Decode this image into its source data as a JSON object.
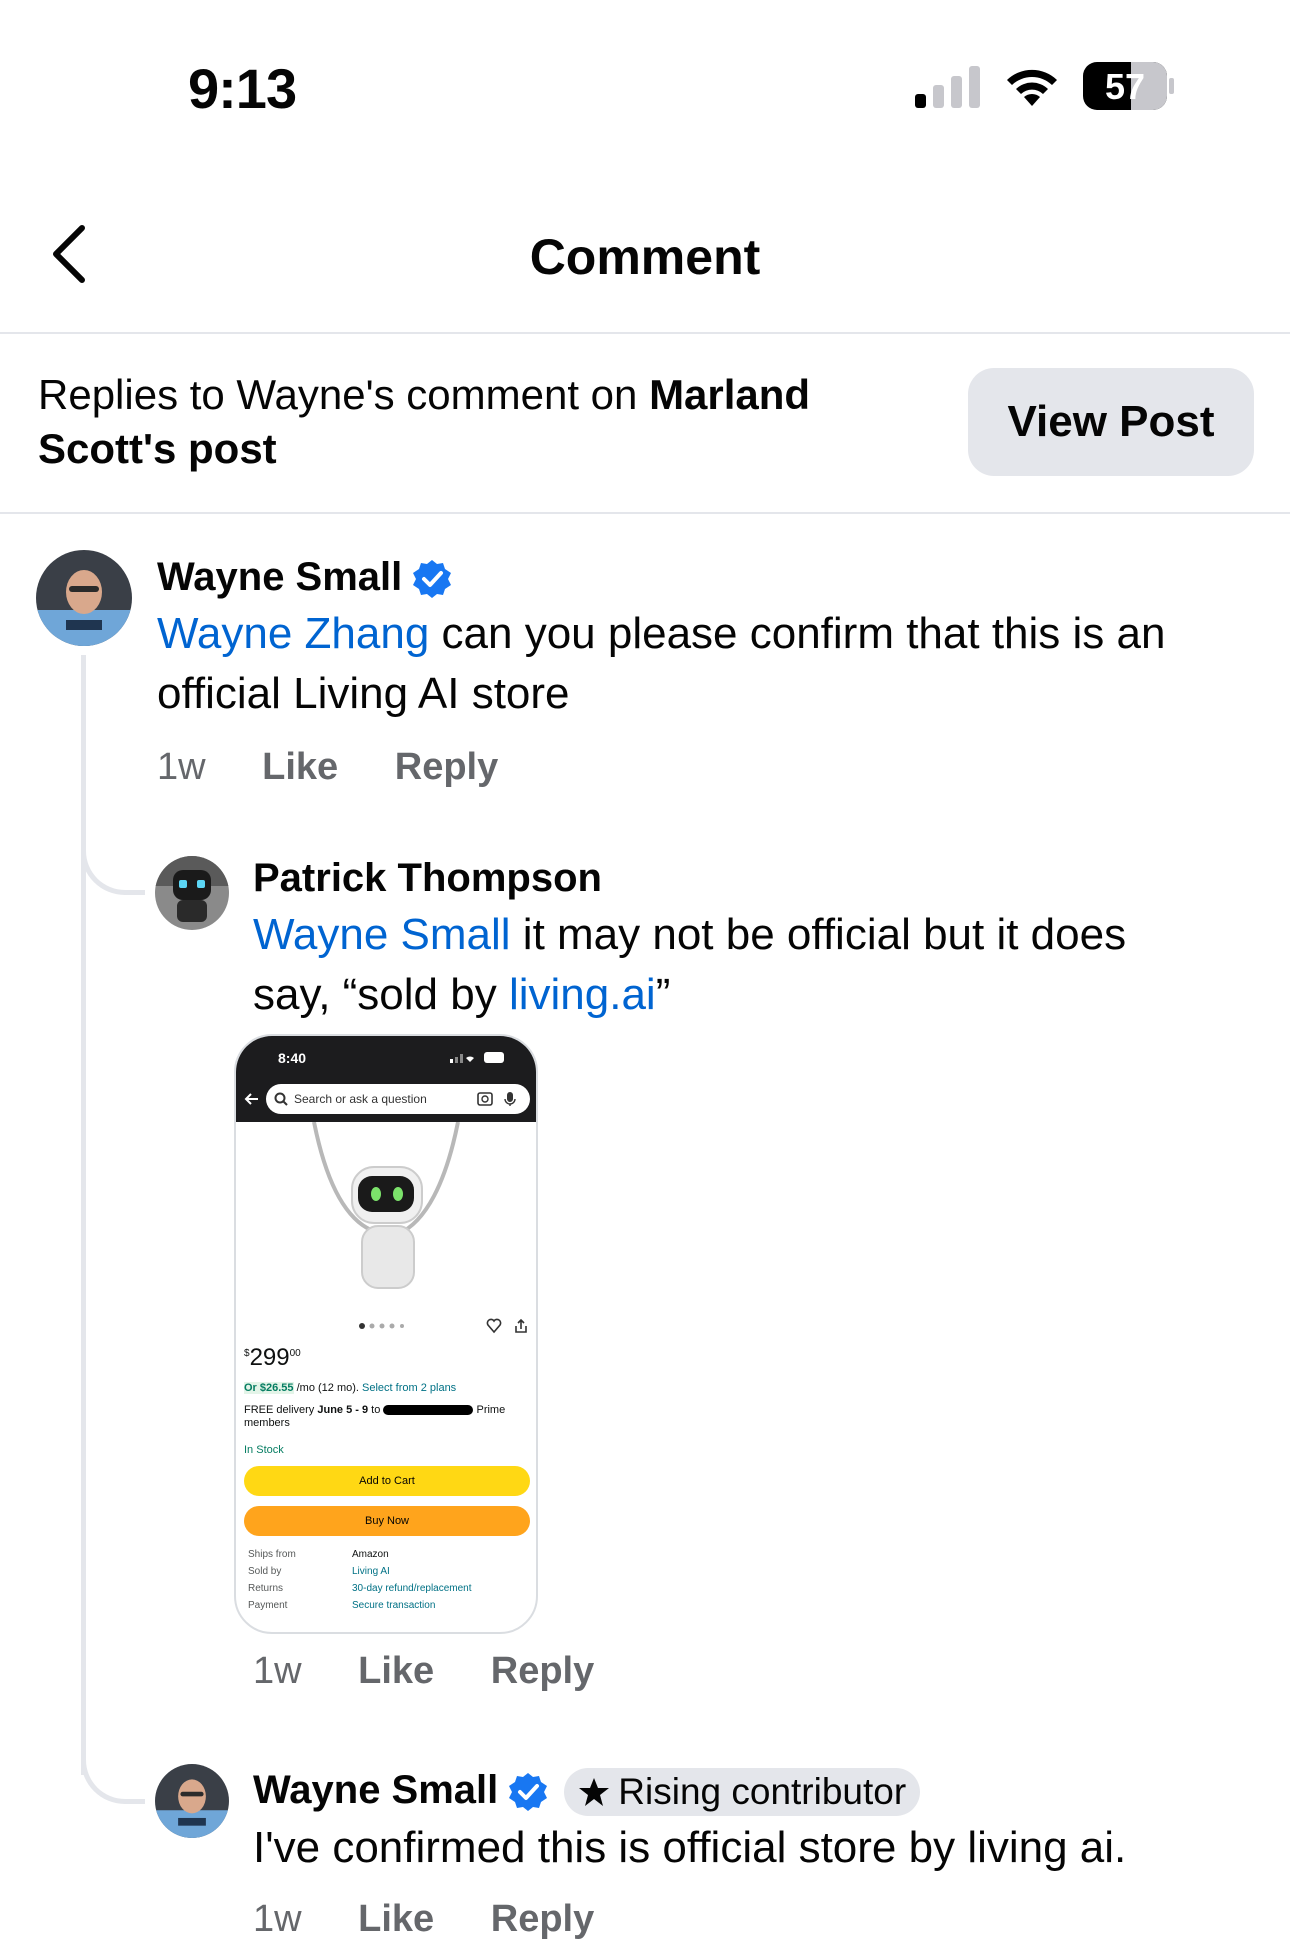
{
  "status_bar": {
    "time": "9:13",
    "battery": "57"
  },
  "header": {
    "title": "Comment"
  },
  "context": {
    "prefix": "Replies to Wayne's comment on ",
    "author": "Marland Scott",
    "suffix": "'s post",
    "view_post_label": "View Post"
  },
  "comments": [
    {
      "name": "Wayne Small",
      "mention": "Wayne Zhang",
      "text": " can you please confirm that this is an official Living AI store",
      "time": "1w",
      "like": "Like",
      "reply": "Reply"
    },
    {
      "name": "Patrick Thompson",
      "mention": "Wayne Small",
      "text_a": " it may not be official but it does say, “sold by ",
      "link": "living.ai",
      "text_b": "”",
      "time": "1w",
      "like": "Like",
      "reply": "Reply",
      "attachment": {
        "time": "8:40",
        "search_placeholder": "Search or ask a question",
        "price_symbol": "$",
        "price_whole": "299",
        "price_fraction": "00",
        "monthly_prefix": "Or $26.55",
        "monthly_text": "/mo (12 mo).",
        "plans_link": "Select from 2 plans",
        "delivery_a": "FREE delivery",
        "delivery_date": "June 5 - 9",
        "delivery_b": "to",
        "delivery_c": "Prime",
        "delivery_d": "members",
        "in_stock": "In Stock",
        "add_to_cart": "Add to Cart",
        "buy_now": "Buy Now",
        "details": [
          {
            "label": "Ships from",
            "value": "Amazon"
          },
          {
            "label": "Sold by",
            "value": "Living AI"
          },
          {
            "label": "Returns",
            "value": "30-day refund/replacement"
          },
          {
            "label": "Payment",
            "value": "Secure transaction"
          }
        ]
      }
    },
    {
      "name": "Wayne Small",
      "badge": "Rising contributor",
      "text": "I've confirmed this is official store by living ai.",
      "time": "1w",
      "like": "Like",
      "reply": "Reply"
    }
  ],
  "colors": {
    "link": "#0064d1",
    "verified": "#1877f2",
    "meta": "#65676b",
    "chip_bg": "#e4e6eb"
  }
}
